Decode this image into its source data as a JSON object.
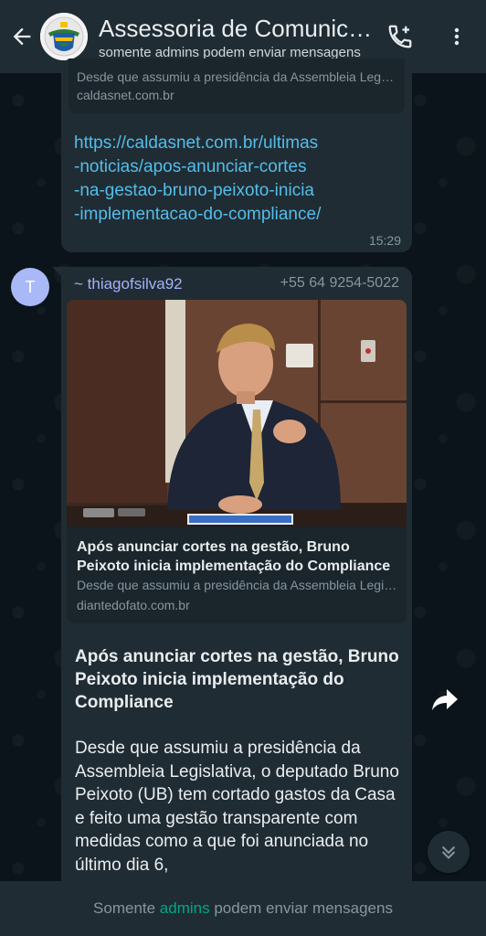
{
  "header": {
    "title": "Assessoria de Comunicação",
    "subtitle": "somente admins podem enviar mensagens"
  },
  "messages": [
    {
      "preview_desc": "Desde que assumiu a presidência da Assembleia Legislativa",
      "preview_domain": "caldasnet.com.br",
      "link_lines": [
        "https://caldasnet.com.br/ultimas",
        "-noticias/apos-anunciar-cortes",
        "-na-gestao-bruno-peixoto-inicia",
        "-implementacao-do-compliance/"
      ],
      "time": "15:29"
    },
    {
      "avatar_initial": "T",
      "sender": "~ thiagofsilva92",
      "phone": "+55 64 9254-5022",
      "card_title": "Após anunciar cortes na gestão, Bruno Peixoto inicia implementação do Compliance",
      "card_desc": "Desde que assumiu a presidência da Assembleia Legislativa",
      "card_domain": "diantedofato.com.br",
      "title": "Após anunciar cortes na gestão, Bruno Peixoto inicia implementação do Compliance",
      "body": "Desde que assumiu a presidência da Assembleia Legislativa, o deputado Bruno Peixoto (UB) tem cortado gastos da Casa e feito uma gestão transparente com medidas como a que foi anunciada no último dia 6,"
    }
  ],
  "footer": {
    "prefix": "Somente ",
    "accent": "admins",
    "suffix": " podem enviar mensagens"
  },
  "icons": {
    "back": "arrow-left-icon",
    "call": "phone-add-icon",
    "menu": "more-vertical-icon",
    "forward": "forward-icon",
    "scroll": "chevrons-down-icon"
  },
  "colors": {
    "background": "#0b141a",
    "header": "#1f2c34",
    "bubble": "#202c33",
    "link": "#53bdeb",
    "accent": "#00a884",
    "sender": "#a5b1f8"
  }
}
